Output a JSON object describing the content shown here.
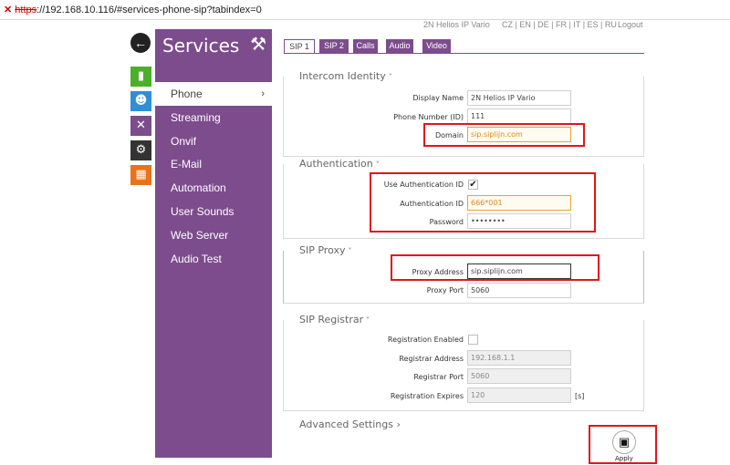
{
  "browser": {
    "url_scheme": "https",
    "url_rest": "://192.168.10.116/#services-phone-sip?tabindex=0"
  },
  "header": {
    "device_name": "2N Helios IP Vario",
    "languages": "CZ | EN | DE | FR | IT | ES | RU",
    "logout": "Logout"
  },
  "sidebar_icons": [
    {
      "name": "status-icon",
      "color": "#4caf2a"
    },
    {
      "name": "users-icon",
      "color": "#2f8fd6"
    },
    {
      "name": "services-icon",
      "color": "#7d4c8d"
    },
    {
      "name": "hardware-icon",
      "color": "#333333"
    },
    {
      "name": "system-icon",
      "color": "#e8731a"
    }
  ],
  "panel": {
    "title": "Services",
    "menu": [
      {
        "label": "Phone",
        "active": true
      },
      {
        "label": "Streaming"
      },
      {
        "label": "Onvif"
      },
      {
        "label": "E-Mail"
      },
      {
        "label": "Automation"
      },
      {
        "label": "User Sounds"
      },
      {
        "label": "Web Server"
      },
      {
        "label": "Audio Test"
      }
    ]
  },
  "tabs": [
    {
      "label": "SIP 1",
      "active": true
    },
    {
      "label": "SIP 2"
    },
    {
      "label": "Calls"
    },
    {
      "label": "Audio"
    },
    {
      "label": "Video"
    }
  ],
  "intercom_identity": {
    "title": "Intercom Identity",
    "display_name_label": "Display Name",
    "display_name_value": "2N Helios IP Vario",
    "phone_number_label": "Phone Number (ID)",
    "phone_number_value": "111",
    "domain_label": "Domain",
    "domain_value": "sip.siplijn.com"
  },
  "authentication": {
    "title": "Authentication",
    "use_auth_id_label": "Use Authentication ID",
    "use_auth_id_checked": true,
    "auth_id_label": "Authentication ID",
    "auth_id_value": "666*001",
    "password_label": "Password",
    "password_value": "••••••••"
  },
  "sip_proxy": {
    "title": "SIP Proxy",
    "proxy_address_label": "Proxy Address",
    "proxy_address_value": "sip.siplijn.com",
    "proxy_port_label": "Proxy Port",
    "proxy_port_value": "5060"
  },
  "sip_registrar": {
    "title": "SIP Registrar",
    "registration_enabled_label": "Registration Enabled",
    "registration_enabled_checked": false,
    "registrar_address_label": "Registrar Address",
    "registrar_address_value": "192.168.1.1",
    "registrar_port_label": "Registrar Port",
    "registrar_port_value": "5060",
    "registration_expires_label": "Registration Expires",
    "registration_expires_value": "120",
    "registration_expires_unit": "[s]"
  },
  "advanced": {
    "label": "Advanced Settings"
  },
  "apply": {
    "label": "Apply"
  },
  "colors": {
    "accent": "#7d4c8d",
    "highlight_box": "#e0161b",
    "field_highlight": "#e8a33a"
  }
}
